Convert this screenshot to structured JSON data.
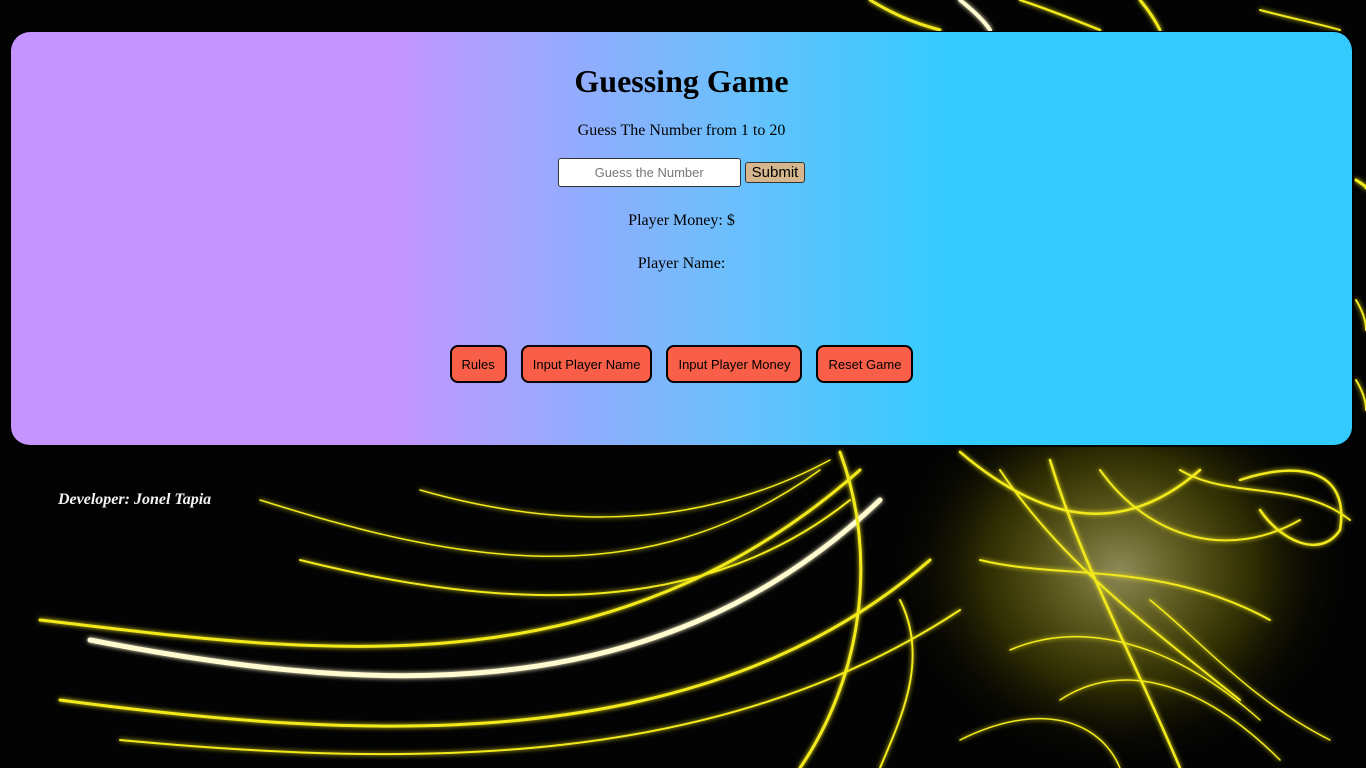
{
  "app": {
    "title": "Guessing Game",
    "subtitle": "Guess The Number from 1 to 20"
  },
  "guess": {
    "placeholder": "Guess the Number",
    "value": "",
    "submit_label": "Submit"
  },
  "player": {
    "money_label": "Player Money: $",
    "money_value": "",
    "name_label": "Player Name:",
    "name_value": ""
  },
  "actions": {
    "rules": "Rules",
    "input_name": "Input Player Name",
    "input_money": "Input Player Money",
    "reset": "Reset Game"
  },
  "footer": {
    "developer_label": "Developer:",
    "developer_name": "Jonel Tapia"
  },
  "colors": {
    "card_left": "#c594fe",
    "card_right": "#33cbfe",
    "action_button": "#f85e48",
    "submit_button": "#d6b68e",
    "background": "#030303",
    "wallpaper_glow": "#ffee33"
  },
  "icons": {
    "background": "yellow-neon-swirl-wallpaper"
  }
}
